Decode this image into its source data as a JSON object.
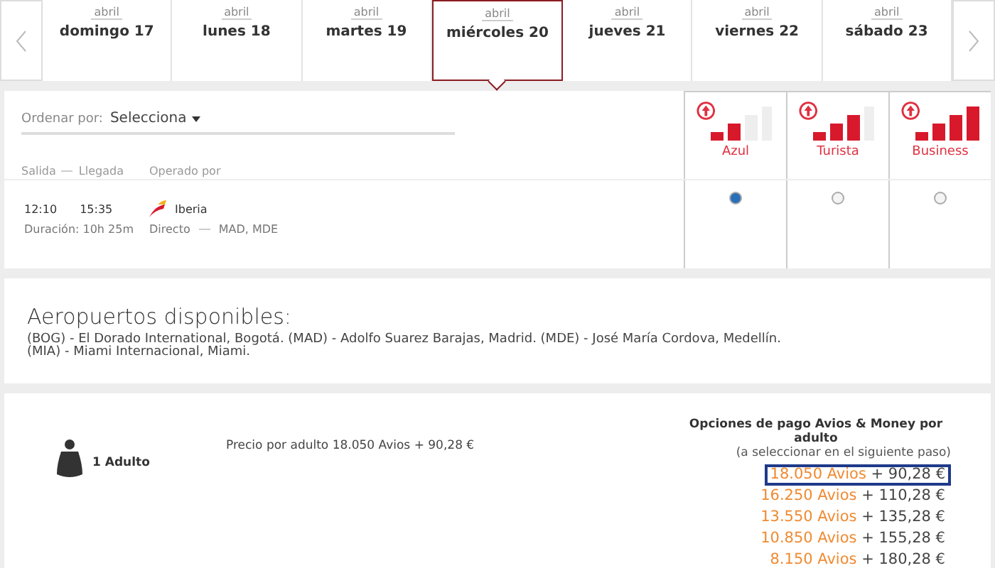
{
  "dates": [
    {
      "month": "abril",
      "day": "domingo 17",
      "selected": false
    },
    {
      "month": "abril",
      "day": "lunes 18",
      "selected": false
    },
    {
      "month": "abril",
      "day": "martes 19",
      "selected": false
    },
    {
      "month": "abril",
      "day": "miércoles 20",
      "selected": true
    },
    {
      "month": "abril",
      "day": "jueves 21",
      "selected": false
    },
    {
      "month": "abril",
      "day": "viernes 22",
      "selected": false
    },
    {
      "month": "abril",
      "day": "sábado 23",
      "selected": false
    }
  ],
  "sort": {
    "label": "Ordenar por:",
    "value": "Selecciona"
  },
  "columns": {
    "departure": "Salida",
    "arrival": "Llegada",
    "operator": "Operado por"
  },
  "fares": [
    {
      "name": "Azul",
      "level": 0.5
    },
    {
      "name": "Turista",
      "level": 0.75
    },
    {
      "name": "Business",
      "level": 1
    }
  ],
  "flight": {
    "departure": "12:10",
    "arrival": "15:35",
    "duration": "Duración: 10h 25m",
    "airline": "Iberia",
    "stops": "Directo",
    "route": "MAD, MDE",
    "fare_choices": [
      {
        "selected": true
      },
      {
        "selected": false
      },
      {
        "selected": false
      }
    ]
  },
  "airports": {
    "title": "Aeropuertos disponibles:",
    "text": "(BOG) - El Dorado International, Bogotá. (MAD) - Adolfo Suarez Barajas, Madrid. (MDE) - José María Cordova, Medellín.",
    "text_2": "(MIA) - Miami Internacional, Miami."
  },
  "passengers": {
    "label": "1 Adulto",
    "price": "Precio por adulto 18.050 Avios + 90,28 €"
  },
  "payment": {
    "title": "Opciones de pago Avios & Money por adulto",
    "note": "(a seleccionar en el siguiente paso)",
    "options": [
      {
        "avios": "18.050 Avios",
        "money": "+ 90,28 €",
        "selected": true
      },
      {
        "avios": "16.250 Avios",
        "money": "+ 110,28 €",
        "selected": false
      },
      {
        "avios": "13.550 Avios",
        "money": "+ 135,28 €",
        "selected": false
      },
      {
        "avios": "10.850 Avios",
        "money": "+ 155,28 €",
        "selected": false
      },
      {
        "avios": "8.150 Avios",
        "money": "+ 180,28 €",
        "selected": false
      }
    ]
  }
}
